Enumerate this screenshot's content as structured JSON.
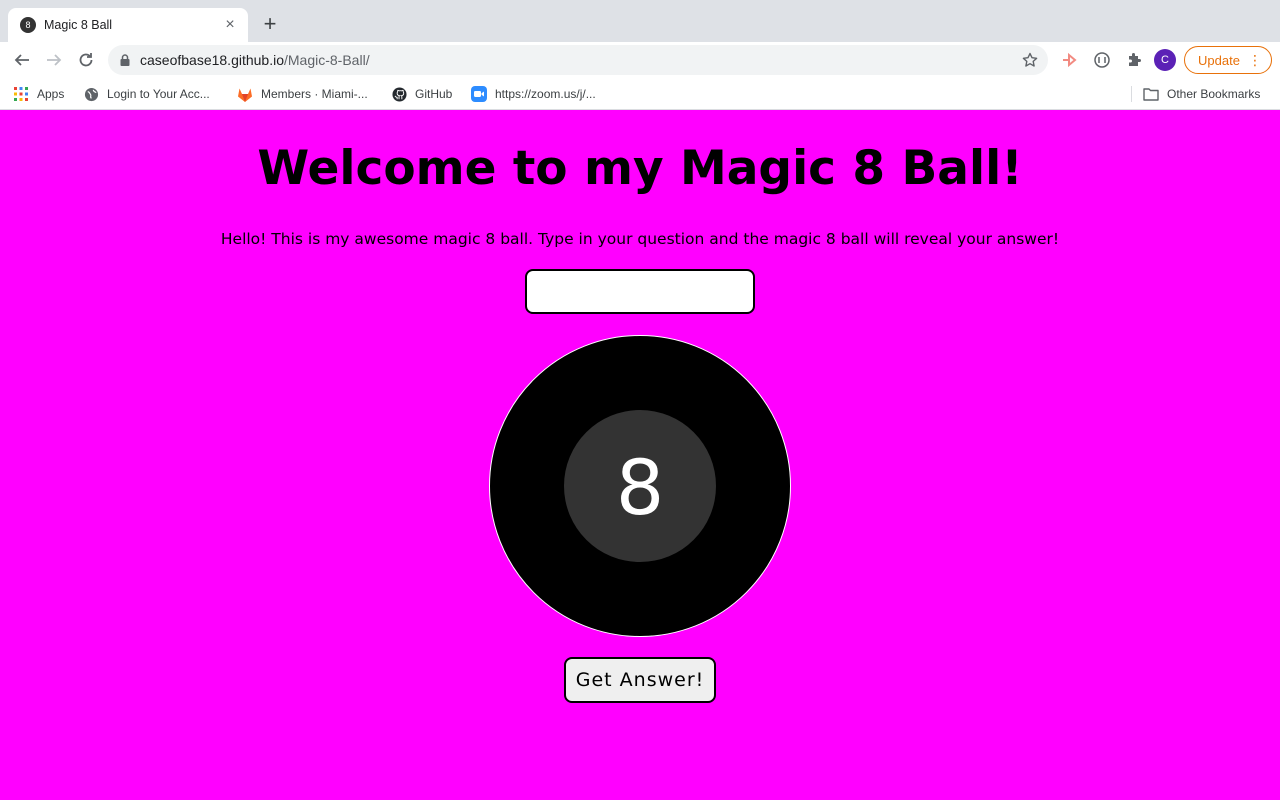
{
  "browser": {
    "tab": {
      "title": "Magic 8 Ball",
      "favicon": "8",
      "close": "×"
    },
    "new_tab": "+",
    "url_host": "caseofbase18.github.io",
    "url_path": "/Magic-8-Ball/",
    "profile_initial": "C",
    "update_label": "Update",
    "update_dots": "⋮",
    "bookmarks": [
      {
        "label": "Apps",
        "icon": "apps-grid-icon"
      },
      {
        "label": "Login to Your Acc...",
        "icon": "globe-icon"
      },
      {
        "label": "Members · Miami-...",
        "icon": "gitlab-icon"
      },
      {
        "label": "GitHub",
        "icon": "github-icon"
      },
      {
        "label": "https://zoom.us/j/...",
        "icon": "zoom-icon"
      }
    ],
    "other_bookmarks": "Other Bookmarks"
  },
  "page": {
    "heading": "Welcome to my Magic 8 Ball!",
    "intro": "Hello! This is my awesome magic 8 ball. Type in your question and the magic 8 ball will reveal your answer!",
    "question_value": "",
    "ball_text": "8",
    "button_label": "Get Answer!",
    "background_color": "#ff00ff"
  }
}
